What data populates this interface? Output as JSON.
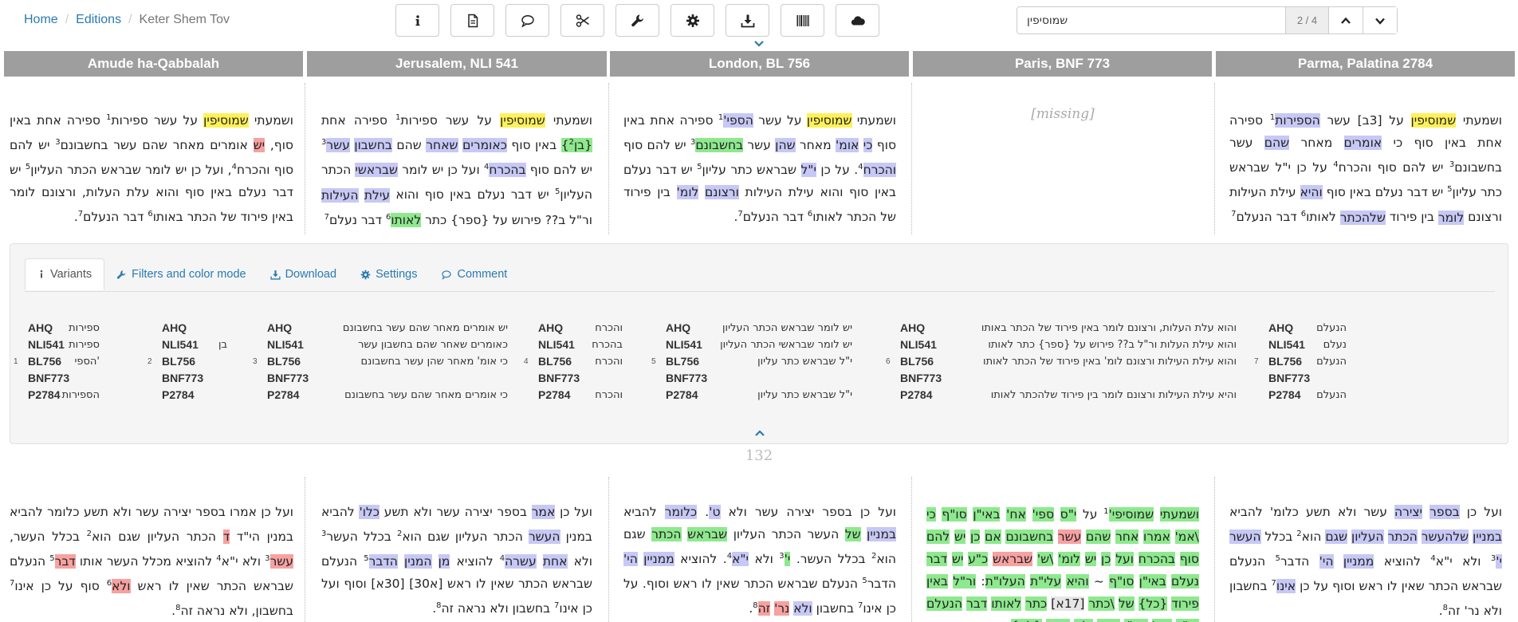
{
  "breadcrumb": {
    "home": "Home",
    "editions": "Editions",
    "current": "Keter Shem Tov"
  },
  "toolbar": {
    "buttons": [
      {
        "name": "info-button",
        "icon": "info-icon"
      },
      {
        "name": "document-button",
        "icon": "document-icon"
      },
      {
        "name": "comment-button",
        "icon": "comment-icon"
      },
      {
        "name": "scissors-button",
        "icon": "scissors-icon"
      },
      {
        "name": "wrench-button",
        "icon": "wrench-icon"
      },
      {
        "name": "settings-button",
        "icon": "gear-icon"
      },
      {
        "name": "download-button",
        "icon": "download-icon"
      },
      {
        "name": "barcode-button",
        "icon": "barcode-icon"
      },
      {
        "name": "cloud-button",
        "icon": "cloud-icon"
      }
    ]
  },
  "search": {
    "value": "שמוסיפין",
    "count": "2 / 4"
  },
  "columns": [
    {
      "title": "Amude ha-Qabbalah"
    },
    {
      "title": "Jerusalem, NLI 541"
    },
    {
      "title": "London, BL 756"
    },
    {
      "title": "Paris, BNF 773",
      "missing": "[missing]"
    },
    {
      "title": "Parma, Palatina 2784"
    }
  ],
  "tabs": {
    "variants": "Variants",
    "filters": "Filters and color mode",
    "download": "Download",
    "settings": "Settings",
    "comment": "Comment"
  },
  "variants": [
    {
      "num": "1",
      "rows": [
        {
          "sig": "AHQ",
          "text": "ספירות"
        },
        {
          "sig": "NLI541",
          "text": "ספירות"
        },
        {
          "sig": "BL756",
          "text": "'הספי"
        },
        {
          "sig": "BNF773",
          "text": ""
        },
        {
          "sig": "P2784",
          "text": "הספירות"
        }
      ]
    },
    {
      "num": "2",
      "rows": [
        {
          "sig": "AHQ",
          "text": ""
        },
        {
          "sig": "NLI541",
          "text": "בן"
        },
        {
          "sig": "BL756",
          "text": ""
        },
        {
          "sig": "BNF773",
          "text": ""
        },
        {
          "sig": "P2784",
          "text": ""
        }
      ]
    },
    {
      "num": "3",
      "rows": [
        {
          "sig": "AHQ",
          "text": "יש אומרים מאחר שהם עשר בחשבונם"
        },
        {
          "sig": "NLI541",
          "text": "כאומרים שאחר שהם בחשבון עשר"
        },
        {
          "sig": "BL756",
          "text": "כי אומ' מאחר שהן עשר בחשבונם"
        },
        {
          "sig": "BNF773",
          "text": ""
        },
        {
          "sig": "P2784",
          "text": "כי אומרים מאחר שהם עשר בחשבונם"
        }
      ]
    },
    {
      "num": "4",
      "rows": [
        {
          "sig": "AHQ",
          "text": "והכרח"
        },
        {
          "sig": "NLI541",
          "text": "בהכרח"
        },
        {
          "sig": "BL756",
          "text": "והכרח"
        },
        {
          "sig": "BNF773",
          "text": ""
        },
        {
          "sig": "P2784",
          "text": "והכרח"
        }
      ]
    },
    {
      "num": "5",
      "rows": [
        {
          "sig": "AHQ",
          "text": "יש לומר שבראש הכתר העליון"
        },
        {
          "sig": "NLI541",
          "text": "יש לומר שבראשי הכתר העליון"
        },
        {
          "sig": "BL756",
          "text": "י\"ל שבראש כתר עליון"
        },
        {
          "sig": "BNF773",
          "text": ""
        },
        {
          "sig": "P2784",
          "text": "י\"ל שבראש כתר עליון"
        }
      ]
    },
    {
      "num": "6",
      "rows": [
        {
          "sig": "AHQ",
          "text": "והוא עלת העלות, ורצונם לומר באין פירוד של הכתר באותו"
        },
        {
          "sig": "NLI541",
          "text": "והוא עילת העלות ור\"ל ב?? פירוש על {ספר} כתר לאותו"
        },
        {
          "sig": "BL756",
          "text": "והוא עילת העילות ורצונם לומ' באין פירוד של הכתר לאותו"
        },
        {
          "sig": "BNF773",
          "text": ""
        },
        {
          "sig": "P2784",
          "text": "והיא עילת העילות ורצונם לומר בין פירוד שלהכתר לאותו"
        }
      ]
    },
    {
      "num": "7",
      "rows": [
        {
          "sig": "AHQ",
          "text": "הנעלם"
        },
        {
          "sig": "NLI541",
          "text": "נעלם"
        },
        {
          "sig": "BL756",
          "text": "הנעלם"
        },
        {
          "sig": "BNF773",
          "text": ""
        },
        {
          "sig": "P2784",
          "text": "הנעלם"
        }
      ]
    }
  ],
  "page_number": "132"
}
